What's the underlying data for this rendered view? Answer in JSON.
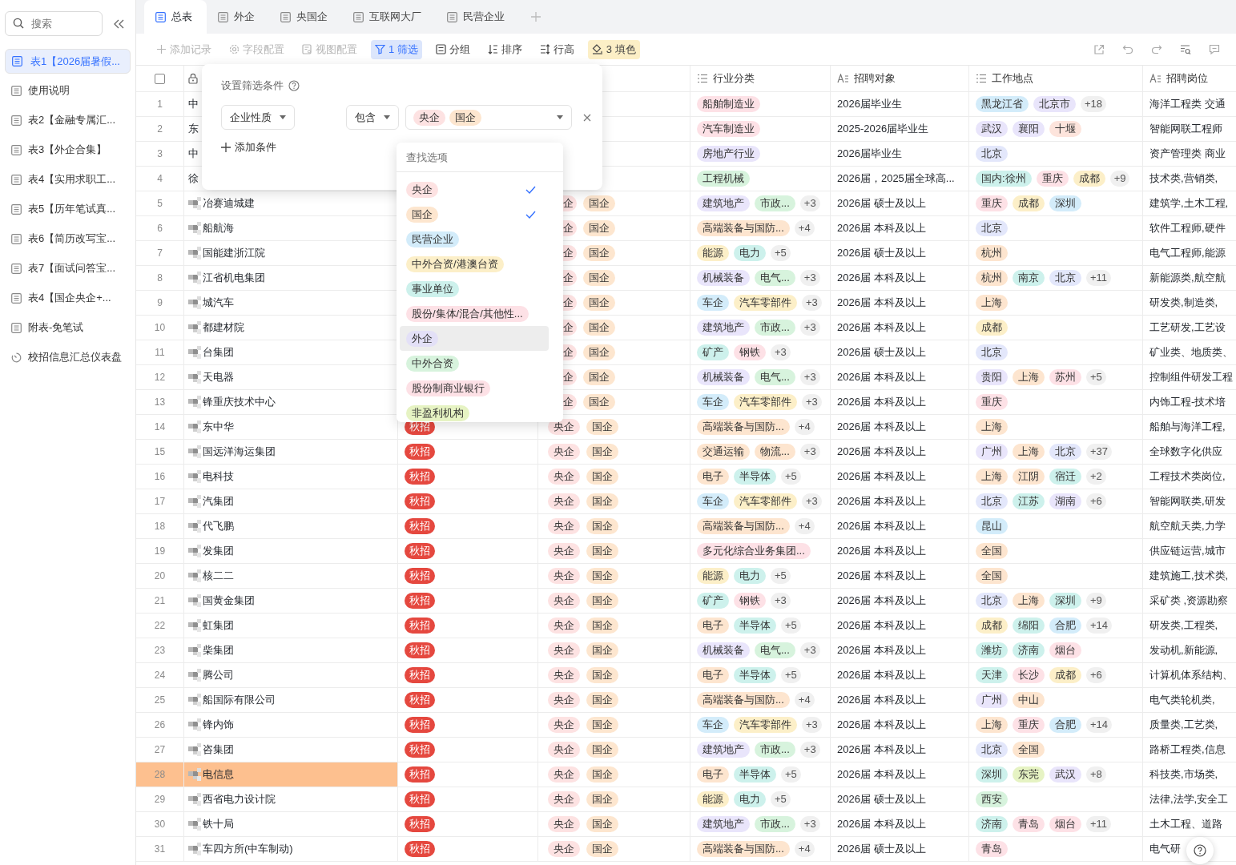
{
  "sidebar": {
    "search": {
      "placeholder": "搜索"
    },
    "items": [
      {
        "label": "表1【2026届暑假...",
        "kind": "table",
        "selected": true
      },
      {
        "label": "使用说明",
        "kind": "table",
        "selected": false
      },
      {
        "label": "表2【金融专属汇...",
        "kind": "table",
        "selected": false
      },
      {
        "label": "表3【外企合集】",
        "kind": "table",
        "selected": false
      },
      {
        "label": "表4【实用求职工...",
        "kind": "table",
        "selected": false
      },
      {
        "label": "表5【历年笔试真...",
        "kind": "table",
        "selected": false
      },
      {
        "label": "表6【简历改写宝...",
        "kind": "table",
        "selected": false
      },
      {
        "label": "表7【面试问答宝...",
        "kind": "table",
        "selected": false
      },
      {
        "label": "表4【国企央企+...",
        "kind": "table",
        "selected": false
      },
      {
        "label": "附表-免笔试",
        "kind": "table",
        "selected": false
      },
      {
        "label": "校招信息汇总仪表盘",
        "kind": "dashboard",
        "selected": false
      }
    ]
  },
  "tabs": [
    {
      "label": "总表",
      "selected": true
    },
    {
      "label": "外企",
      "selected": false
    },
    {
      "label": "央国企",
      "selected": false
    },
    {
      "label": "互联网大厂",
      "selected": false
    },
    {
      "label": "民营企业",
      "selected": false
    }
  ],
  "toolbar": [
    {
      "label": "添加记录",
      "kind": "add",
      "disabled": true,
      "active": false
    },
    {
      "label": "字段配置",
      "kind": "field",
      "disabled": true,
      "active": false
    },
    {
      "label": "视图配置",
      "kind": "view",
      "disabled": true,
      "active": false
    },
    {
      "label": "1 筛选",
      "kind": "filter",
      "disabled": false,
      "active": true
    },
    {
      "label": "分组",
      "kind": "group",
      "disabled": false,
      "active": false
    },
    {
      "label": "排序",
      "kind": "sort",
      "disabled": false,
      "active": false
    },
    {
      "label": "行高",
      "kind": "height",
      "disabled": false,
      "active": false
    },
    {
      "label": "3 填色",
      "kind": "fill",
      "disabled": false,
      "active": true
    }
  ],
  "toolbar_icons": [
    {
      "kind": "share"
    },
    {
      "kind": "undo"
    },
    {
      "kind": "redo"
    },
    {
      "kind": "find"
    },
    {
      "kind": "comment"
    }
  ],
  "select_all": {
    "checked": false
  },
  "columns": [
    {
      "label": "行业分类",
      "kind": "list"
    },
    {
      "label": "招聘对象",
      "kind": "text"
    },
    {
      "label": "工作地点",
      "kind": "list"
    },
    {
      "label": "招聘岗位",
      "kind": "text"
    }
  ],
  "rows": [
    {
      "no": "1",
      "name": "中",
      "redacted": false,
      "highlighted": false,
      "org": [],
      "industry": [
        {
          "label": "船舶制造业",
          "color": "#fde1e6"
        }
      ],
      "target": "2026届毕业生",
      "locations": [
        {
          "label": "黑龙江省",
          "color": "#d3ecfa"
        },
        {
          "label": "北京市",
          "color": "#e9e5fb"
        }
      ],
      "locations_more": "+18",
      "position": "海洋工程类 交通"
    },
    {
      "no": "2",
      "name": "东",
      "redacted": false,
      "highlighted": false,
      "org": [],
      "industry": [
        {
          "label": "汽车制造业",
          "color": "#fde1e6"
        }
      ],
      "target": "2025-2026届毕业生",
      "locations": [
        {
          "label": "武汉",
          "color": "#e9e5fb"
        },
        {
          "label": "襄阳",
          "color": "#e9e5fb"
        },
        {
          "label": "十堰",
          "color": "#fde4dc"
        }
      ],
      "position": "智能网联工程师"
    },
    {
      "no": "3",
      "name": "中",
      "redacted": false,
      "highlighted": false,
      "org": [],
      "industry": [
        {
          "label": "房地产行业",
          "color": "#e9e5fb"
        }
      ],
      "target": "2026届毕业生",
      "locations": [
        {
          "label": "北京",
          "color": "#e3e7fb"
        }
      ],
      "position": "资产管理类 商业"
    },
    {
      "no": "4",
      "name": "徐",
      "redacted": false,
      "highlighted": false,
      "org": [],
      "industry": [
        {
          "label": "工程机械",
          "color": "#d7f3dd"
        }
      ],
      "target": "2026届，2025届全球高...",
      "locations": [
        {
          "label": "国内:徐州",
          "color": "#cdf1ec"
        },
        {
          "label": "重庆",
          "color": "#fde1e6"
        },
        {
          "label": "成都",
          "color": "#fcefc8"
        }
      ],
      "locations_more": "+9",
      "position": "技术类,营销类,"
    },
    {
      "no": "5",
      "name": "冶赛迪城建",
      "redacted": true,
      "highlighted": false,
      "org": [
        {
          "label": "企",
          "color": "#fde2e2",
          "cut": true
        },
        {
          "label": "国企",
          "color": "#fde6cf",
          "cut": false
        }
      ],
      "industry": [
        {
          "label": "建筑地产",
          "color": "#e9e5fb"
        },
        {
          "label": "市政...",
          "color": "#d7f3dd"
        }
      ],
      "industry_more": "+3",
      "target": "2026届 硕士及以上",
      "locations": [
        {
          "label": "重庆",
          "color": "#fde1e6"
        },
        {
          "label": "成都",
          "color": "#fcefc8"
        },
        {
          "label": "深圳",
          "color": "#d3ecfa"
        }
      ],
      "position": "建筑学,土木工程,"
    },
    {
      "no": "6",
      "name": "船航海",
      "redacted": true,
      "highlighted": false,
      "org": [
        {
          "label": "企",
          "color": "#fde2e2",
          "cut": true
        },
        {
          "label": "国企",
          "color": "#fde6cf",
          "cut": false
        }
      ],
      "industry": [
        {
          "label": "高端装备与国防...",
          "color": "#fde5cf"
        }
      ],
      "industry_more": "+4",
      "target": "2026届 本科及以上",
      "locations": [
        {
          "label": "北京",
          "color": "#e3e7fb"
        }
      ],
      "position": "软件工程师,硬件"
    },
    {
      "no": "7",
      "name": "国能建浙江院",
      "redacted": true,
      "highlighted": false,
      "org": [
        {
          "label": "企",
          "color": "#fde2e2",
          "cut": true
        },
        {
          "label": "国企",
          "color": "#fde6cf",
          "cut": false
        }
      ],
      "industry": [
        {
          "label": "能源",
          "color": "#fcefc8"
        },
        {
          "label": "电力",
          "color": "#cdf1ec"
        }
      ],
      "industry_more": "+5",
      "target": "2026届 硕士及以上",
      "locations": [
        {
          "label": "杭州",
          "color": "#fde5cf"
        }
      ],
      "position": "电气工程师,能源"
    },
    {
      "no": "8",
      "name": "江省机电集团",
      "redacted": true,
      "highlighted": false,
      "org": [
        {
          "label": "企",
          "color": "#fde2e2",
          "cut": true
        },
        {
          "label": "国企",
          "color": "#fde6cf",
          "cut": false
        }
      ],
      "industry": [
        {
          "label": "机械装备",
          "color": "#e9e5fb"
        },
        {
          "label": "电气...",
          "color": "#d7f3dd"
        }
      ],
      "industry_more": "+3",
      "target": "2026届 本科及以上",
      "locations": [
        {
          "label": "杭州",
          "color": "#fde5cf"
        },
        {
          "label": "南京",
          "color": "#cdf1ec"
        },
        {
          "label": "北京",
          "color": "#e3e7fb"
        }
      ],
      "locations_more": "+11",
      "position": "新能源类,航空航"
    },
    {
      "no": "9",
      "name": "城汽车",
      "redacted": true,
      "highlighted": false,
      "org": [
        {
          "label": "企",
          "color": "#fde2e2",
          "cut": true
        },
        {
          "label": "国企",
          "color": "#fde6cf",
          "cut": false
        }
      ],
      "industry": [
        {
          "label": "车企",
          "color": "#d3ecfa"
        },
        {
          "label": "汽车零部件",
          "color": "#fcefc8"
        }
      ],
      "industry_more": "+3",
      "target": "2026届 本科及以上",
      "locations": [
        {
          "label": "上海",
          "color": "#fde5cf"
        }
      ],
      "position": "研发类,制造类,"
    },
    {
      "no": "10",
      "name": "都建材院",
      "redacted": true,
      "highlighted": false,
      "org": [
        {
          "label": "企",
          "color": "#fde2e2",
          "cut": true
        },
        {
          "label": "国企",
          "color": "#fde6cf",
          "cut": false
        }
      ],
      "industry": [
        {
          "label": "建筑地产",
          "color": "#e9e5fb"
        },
        {
          "label": "市政...",
          "color": "#d7f3dd"
        }
      ],
      "industry_more": "+3",
      "target": "2026届 本科及以上",
      "locations": [
        {
          "label": "成都",
          "color": "#fcefc8"
        }
      ],
      "position": "工艺研发,工艺设"
    },
    {
      "no": "11",
      "name": "台集团",
      "redacted": true,
      "highlighted": false,
      "org": [
        {
          "label": "企",
          "color": "#fde2e2",
          "cut": true
        },
        {
          "label": "国企",
          "color": "#fde6cf",
          "cut": false
        }
      ],
      "industry": [
        {
          "label": "矿产",
          "color": "#cdf1ec"
        },
        {
          "label": "钢铁",
          "color": "#fde1e6"
        }
      ],
      "industry_more": "+3",
      "target": "2026届 硕士及以上",
      "locations": [
        {
          "label": "北京",
          "color": "#e3e7fb"
        }
      ],
      "position": "矿业类、地质类、"
    },
    {
      "no": "12",
      "name": "天电器",
      "redacted": true,
      "highlighted": false,
      "org": [
        {
          "label": "企",
          "color": "#fde2e2",
          "cut": true
        },
        {
          "label": "国企",
          "color": "#fde6cf",
          "cut": false
        }
      ],
      "industry": [
        {
          "label": "机械装备",
          "color": "#e9e5fb"
        },
        {
          "label": "电气...",
          "color": "#d7f3dd"
        }
      ],
      "industry_more": "+3",
      "target": "2026届 本科及以上",
      "locations": [
        {
          "label": "贵阳",
          "color": "#e9e5fb"
        },
        {
          "label": "上海",
          "color": "#fde5cf"
        },
        {
          "label": "苏州",
          "color": "#fde1e6"
        }
      ],
      "locations_more": "+5",
      "position": "控制组件研发工程"
    },
    {
      "no": "13",
      "name": "锋重庆技术中心",
      "redacted": true,
      "highlighted": false,
      "org": [
        {
          "label": "企",
          "color": "#fde2e2",
          "cut": true
        },
        {
          "label": "国企",
          "color": "#fde6cf",
          "cut": false
        }
      ],
      "industry": [
        {
          "label": "车企",
          "color": "#d3ecfa"
        },
        {
          "label": "汽车零部件",
          "color": "#fcefc8"
        }
      ],
      "industry_more": "+3",
      "target": "2026届 本科及以上",
      "locations": [
        {
          "label": "重庆",
          "color": "#fde1e6"
        }
      ],
      "position": "内饰工程-技术培"
    },
    {
      "no": "14",
      "name": "东中华",
      "redacted": true,
      "highlighted": false,
      "recruit": "秋招",
      "org": [
        {
          "label": "央企",
          "color": "#fde2e2",
          "cut": false
        },
        {
          "label": "国企",
          "color": "#fde6cf",
          "cut": false
        }
      ],
      "industry": [
        {
          "label": "高端装备与国防...",
          "color": "#fde5cf"
        }
      ],
      "industry_more": "+4",
      "target": "2026届 本科及以上",
      "locations": [
        {
          "label": "上海",
          "color": "#fde5cf"
        }
      ],
      "position": "船舶与海洋工程,"
    },
    {
      "no": "15",
      "name": "国远洋海运集团",
      "redacted": true,
      "highlighted": false,
      "recruit": "秋招",
      "org": [
        {
          "label": "央企",
          "color": "#fde2e2",
          "cut": false
        },
        {
          "label": "国企",
          "color": "#fde6cf",
          "cut": false
        }
      ],
      "industry": [
        {
          "label": "交通运输",
          "color": "#fde5cf"
        },
        {
          "label": "物流...",
          "color": "#fde5cf"
        }
      ],
      "industry_more": "+3",
      "target": "2026届 本科及以上",
      "locations": [
        {
          "label": "广州",
          "color": "#e9e5fb"
        },
        {
          "label": "上海",
          "color": "#fde5cf"
        },
        {
          "label": "北京",
          "color": "#e3e7fb"
        }
      ],
      "locations_more": "+37",
      "position": "全球数字化供应"
    },
    {
      "no": "16",
      "name": "电科技",
      "redacted": true,
      "highlighted": false,
      "recruit": "秋招",
      "org": [
        {
          "label": "央企",
          "color": "#fde2e2",
          "cut": false
        },
        {
          "label": "国企",
          "color": "#fde6cf",
          "cut": false
        }
      ],
      "industry": [
        {
          "label": "电子",
          "color": "#fde5cf"
        },
        {
          "label": "半导体",
          "color": "#cdf1ec"
        }
      ],
      "industry_more": "+5",
      "target": "2026届 本科及以上",
      "locations": [
        {
          "label": "上海",
          "color": "#fde5cf"
        },
        {
          "label": "江阴",
          "color": "#fde5cf"
        },
        {
          "label": "宿迁",
          "color": "#cdf1ec"
        }
      ],
      "locations_more": "+2",
      "position": "工程技术类岗位,"
    },
    {
      "no": "17",
      "name": "汽集团",
      "redacted": true,
      "highlighted": false,
      "recruit": "秋招",
      "org": [
        {
          "label": "央企",
          "color": "#fde2e2",
          "cut": false
        },
        {
          "label": "国企",
          "color": "#fde6cf",
          "cut": false
        }
      ],
      "industry": [
        {
          "label": "车企",
          "color": "#d3ecfa"
        },
        {
          "label": "汽车零部件",
          "color": "#fcefc8"
        }
      ],
      "industry_more": "+3",
      "target": "2026届 本科及以上",
      "locations": [
        {
          "label": "北京",
          "color": "#e3e7fb"
        },
        {
          "label": "江苏",
          "color": "#cdf1ec"
        },
        {
          "label": "湖南",
          "color": "#e9e5fb"
        }
      ],
      "locations_more": "+6",
      "position": "智能网联类,研发"
    },
    {
      "no": "18",
      "name": "代飞鹏",
      "redacted": true,
      "highlighted": false,
      "recruit": "秋招",
      "org": [
        {
          "label": "央企",
          "color": "#fde2e2",
          "cut": false
        },
        {
          "label": "国企",
          "color": "#fde6cf",
          "cut": false
        }
      ],
      "industry": [
        {
          "label": "高端装备与国防...",
          "color": "#fde5cf"
        }
      ],
      "industry_more": "+4",
      "target": "2026届 本科及以上",
      "locations": [
        {
          "label": "昆山",
          "color": "#d3ecfa"
        }
      ],
      "position": "航空航天类,力学"
    },
    {
      "no": "19",
      "name": "发集团",
      "redacted": true,
      "highlighted": false,
      "recruit": "秋招",
      "org": [
        {
          "label": "央企",
          "color": "#fde2e2",
          "cut": false
        },
        {
          "label": "国企",
          "color": "#fde6cf",
          "cut": false
        }
      ],
      "industry": [
        {
          "label": "多元化综合业务集团...",
          "color": "#fde1e6"
        }
      ],
      "target": "2026届 本科及以上",
      "locations": [
        {
          "label": "全国",
          "color": "#fde5cf"
        }
      ],
      "position": "供应链运营,城市"
    },
    {
      "no": "20",
      "name": "核二二",
      "redacted": true,
      "highlighted": false,
      "recruit": "秋招",
      "org": [
        {
          "label": "央企",
          "color": "#fde2e2",
          "cut": false
        },
        {
          "label": "国企",
          "color": "#fde6cf",
          "cut": false
        }
      ],
      "industry": [
        {
          "label": "能源",
          "color": "#fcefc8"
        },
        {
          "label": "电力",
          "color": "#cdf1ec"
        }
      ],
      "industry_more": "+5",
      "target": "2026届 本科及以上",
      "locations": [
        {
          "label": "全国",
          "color": "#fde5cf"
        }
      ],
      "position": "建筑施工,技术类,"
    },
    {
      "no": "21",
      "name": "国黄金集团",
      "redacted": true,
      "highlighted": false,
      "recruit": "秋招",
      "org": [
        {
          "label": "央企",
          "color": "#fde2e2",
          "cut": false
        },
        {
          "label": "国企",
          "color": "#fde6cf",
          "cut": false
        }
      ],
      "industry": [
        {
          "label": "矿产",
          "color": "#cdf1ec"
        },
        {
          "label": "钢铁",
          "color": "#fde1e6"
        }
      ],
      "industry_more": "+3",
      "target": "2026届 本科及以上",
      "locations": [
        {
          "label": "北京",
          "color": "#e3e7fb"
        },
        {
          "label": "上海",
          "color": "#fde5cf"
        },
        {
          "label": "深圳",
          "color": "#cdf1ec"
        }
      ],
      "locations_more": "+9",
      "position": "采矿类 ,资源勘察"
    },
    {
      "no": "22",
      "name": "虹集团",
      "redacted": true,
      "highlighted": false,
      "recruit": "秋招",
      "org": [
        {
          "label": "央企",
          "color": "#fde2e2",
          "cut": false
        },
        {
          "label": "国企",
          "color": "#fde6cf",
          "cut": false
        }
      ],
      "industry": [
        {
          "label": "电子",
          "color": "#fde5cf"
        },
        {
          "label": "半导体",
          "color": "#cdf1ec"
        }
      ],
      "industry_more": "+5",
      "target": "2026届 本科及以上",
      "locations": [
        {
          "label": "成都",
          "color": "#fcefc8"
        },
        {
          "label": "绵阳",
          "color": "#cdf1ec"
        },
        {
          "label": "合肥",
          "color": "#d3ecfa"
        }
      ],
      "locations_more": "+14",
      "position": "研发类,工程类,"
    },
    {
      "no": "23",
      "name": "柴集团",
      "redacted": true,
      "highlighted": false,
      "recruit": "秋招",
      "org": [
        {
          "label": "央企",
          "color": "#fde2e2",
          "cut": false
        },
        {
          "label": "国企",
          "color": "#fde6cf",
          "cut": false
        }
      ],
      "industry": [
        {
          "label": "机械装备",
          "color": "#e9e5fb"
        },
        {
          "label": "电气...",
          "color": "#d7f3dd"
        }
      ],
      "industry_more": "+3",
      "target": "2026届 本科及以上",
      "locations": [
        {
          "label": "潍坊",
          "color": "#cdf1ec"
        },
        {
          "label": "济南",
          "color": "#cdf1ec"
        },
        {
          "label": "烟台",
          "color": "#fde1e6"
        }
      ],
      "position": "发动机,新能源,"
    },
    {
      "no": "24",
      "name": "腾公司",
      "redacted": true,
      "highlighted": false,
      "recruit": "秋招",
      "org": [
        {
          "label": "央企",
          "color": "#fde2e2",
          "cut": false
        },
        {
          "label": "国企",
          "color": "#fde6cf",
          "cut": false
        }
      ],
      "industry": [
        {
          "label": "电子",
          "color": "#fde5cf"
        },
        {
          "label": "半导体",
          "color": "#cdf1ec"
        }
      ],
      "industry_more": "+5",
      "target": "2026届 本科及以上",
      "locations": [
        {
          "label": "天津",
          "color": "#cdf1ec"
        },
        {
          "label": "长沙",
          "color": "#fde1e6"
        },
        {
          "label": "成都",
          "color": "#fcefc8"
        }
      ],
      "locations_more": "+6",
      "position": "计算机体系结构、"
    },
    {
      "no": "25",
      "name": "船国际有限公司",
      "redacted": true,
      "highlighted": false,
      "recruit": "秋招",
      "org": [
        {
          "label": "央企",
          "color": "#fde2e2",
          "cut": false
        },
        {
          "label": "国企",
          "color": "#fde6cf",
          "cut": false
        }
      ],
      "industry": [
        {
          "label": "高端装备与国防...",
          "color": "#fde5cf"
        }
      ],
      "industry_more": "+4",
      "target": "2026届 本科及以上",
      "locations": [
        {
          "label": "广州",
          "color": "#e9e5fb"
        },
        {
          "label": "中山",
          "color": "#fde5cf"
        }
      ],
      "position": "电气类轮机类,"
    },
    {
      "no": "26",
      "name": "锋内饰",
      "redacted": true,
      "highlighted": false,
      "recruit": "秋招",
      "org": [
        {
          "label": "央企",
          "color": "#fde2e2",
          "cut": false
        },
        {
          "label": "国企",
          "color": "#fde6cf",
          "cut": false
        }
      ],
      "industry": [
        {
          "label": "车企",
          "color": "#d3ecfa"
        },
        {
          "label": "汽车零部件",
          "color": "#fcefc8"
        }
      ],
      "industry_more": "+3",
      "target": "2026届 本科及以上",
      "locations": [
        {
          "label": "上海",
          "color": "#fde5cf"
        },
        {
          "label": "重庆",
          "color": "#fde1e6"
        },
        {
          "label": "合肥",
          "color": "#d3ecfa"
        }
      ],
      "locations_more": "+14",
      "position": "质量类,工艺类,"
    },
    {
      "no": "27",
      "name": "咨集团",
      "redacted": true,
      "highlighted": false,
      "recruit": "秋招",
      "org": [
        {
          "label": "央企",
          "color": "#fde2e2",
          "cut": false
        },
        {
          "label": "国企",
          "color": "#fde6cf",
          "cut": false
        }
      ],
      "industry": [
        {
          "label": "建筑地产",
          "color": "#e9e5fb"
        },
        {
          "label": "市政...",
          "color": "#d7f3dd"
        }
      ],
      "industry_more": "+3",
      "target": "2026届 本科及以上",
      "locations": [
        {
          "label": "北京",
          "color": "#e3e7fb"
        },
        {
          "label": "全国",
          "color": "#fde5cf"
        }
      ],
      "position": "路桥工程类,信息"
    },
    {
      "no": "28",
      "name": "电信息",
      "redacted": true,
      "highlighted": true,
      "recruit": "秋招",
      "org": [
        {
          "label": "央企",
          "color": "#fde2e2",
          "cut": false
        },
        {
          "label": "国企",
          "color": "#fde6cf",
          "cut": false
        }
      ],
      "industry": [
        {
          "label": "电子",
          "color": "#fde5cf"
        },
        {
          "label": "半导体",
          "color": "#cdf1ec"
        }
      ],
      "industry_more": "+5",
      "target": "2026届 本科及以上",
      "locations": [
        {
          "label": "深圳",
          "color": "#cdf1ec"
        },
        {
          "label": "东莞",
          "color": "#e6f3c3"
        },
        {
          "label": "武汉",
          "color": "#e9e5fb"
        }
      ],
      "locations_more": "+8",
      "position": "科技类,市场类,"
    },
    {
      "no": "29",
      "name": "西省电力设计院",
      "redacted": true,
      "highlighted": false,
      "recruit": "秋招",
      "org": [
        {
          "label": "央企",
          "color": "#fde2e2",
          "cut": false
        },
        {
          "label": "国企",
          "color": "#fde6cf",
          "cut": false
        }
      ],
      "industry": [
        {
          "label": "能源",
          "color": "#fcefc8"
        },
        {
          "label": "电力",
          "color": "#cdf1ec"
        }
      ],
      "industry_more": "+5",
      "target": "2026届 硕士及以上",
      "locations": [
        {
          "label": "西安",
          "color": "#d7f3dd"
        }
      ],
      "position": "法律,法学,安全工"
    },
    {
      "no": "30",
      "name": "铁十局",
      "redacted": true,
      "highlighted": false,
      "recruit": "秋招",
      "org": [
        {
          "label": "央企",
          "color": "#fde2e2",
          "cut": false
        },
        {
          "label": "国企",
          "color": "#fde6cf",
          "cut": false
        }
      ],
      "industry": [
        {
          "label": "建筑地产",
          "color": "#e9e5fb"
        },
        {
          "label": "市政...",
          "color": "#d7f3dd"
        }
      ],
      "industry_more": "+3",
      "target": "2026届 本科及以上",
      "locations": [
        {
          "label": "济南",
          "color": "#cdf1ec"
        },
        {
          "label": "青岛",
          "color": "#fde1e6"
        },
        {
          "label": "烟台",
          "color": "#fde1e6"
        }
      ],
      "locations_more": "+11",
      "position": "土木工程、道路"
    },
    {
      "no": "31",
      "name": "车四方所(中车制动)",
      "redacted": true,
      "highlighted": false,
      "recruit": "秋招",
      "org": [
        {
          "label": "央企",
          "color": "#fde2e2",
          "cut": false
        },
        {
          "label": "国企",
          "color": "#fde6cf",
          "cut": false
        }
      ],
      "industry": [
        {
          "label": "高端装备与国防...",
          "color": "#fde5cf"
        }
      ],
      "industry_more": "+4",
      "target": "2026届 硕士及以上",
      "locations": [
        {
          "label": "青岛",
          "color": "#fde1e6"
        }
      ],
      "position": "电气研"
    }
  ],
  "filter": {
    "title": "设置筛选条件",
    "field": "企业性质",
    "operator": "包含",
    "values": [
      {
        "label": "央企",
        "color": "#fde2e2"
      },
      {
        "label": "国企",
        "color": "#fde6cf"
      }
    ],
    "add_label": "添加条件",
    "search_placeholder": "查找选项",
    "options": [
      {
        "label": "央企",
        "color": "#fde2e2",
        "selected": true,
        "hovered": false
      },
      {
        "label": "国企",
        "color": "#fde6cf",
        "selected": true,
        "hovered": false
      },
      {
        "label": "民营企业",
        "color": "#d3ecfa",
        "selected": false,
        "hovered": false
      },
      {
        "label": "中外合资/港澳台资",
        "color": "#fcefc8",
        "selected": false,
        "hovered": false
      },
      {
        "label": "事业单位",
        "color": "#cdf1ec",
        "selected": false,
        "hovered": false
      },
      {
        "label": "股份/集体/混合/其他性...",
        "color": "#fde1e6",
        "selected": false,
        "hovered": false
      },
      {
        "label": "外企",
        "color": "#e3e0f7",
        "selected": false,
        "hovered": true
      },
      {
        "label": "中外合资",
        "color": "#d7f3dd",
        "selected": false,
        "hovered": false
      },
      {
        "label": "股份制商业银行",
        "color": "#fde1e6",
        "selected": false,
        "hovered": false
      },
      {
        "label": "非盈利机构",
        "color": "#e6f3c3",
        "selected": false,
        "hovered": false
      }
    ]
  }
}
